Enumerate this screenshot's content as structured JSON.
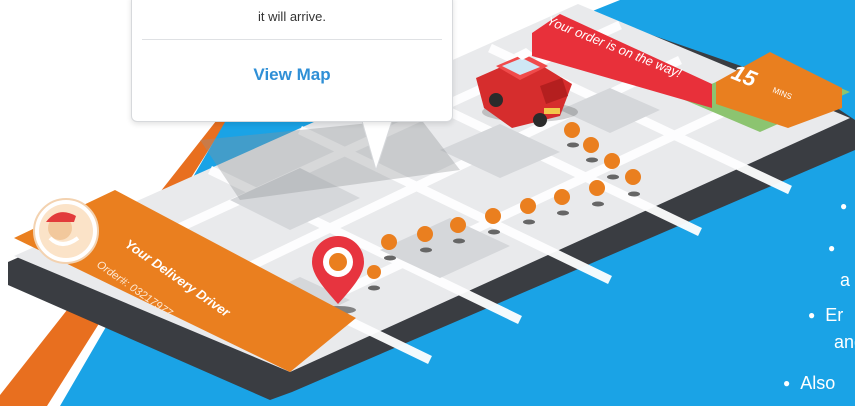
{
  "popover": {
    "message_tail": "it will arrive.",
    "link_label": "View Map"
  },
  "banner": {
    "status_text": "Your order is on the way!",
    "eta_value": "15",
    "eta_unit": "MINS"
  },
  "driver_card": {
    "title": "Your Delivery Driver",
    "order_label": "Order#: 03217977"
  },
  "bullets": [
    {
      "text": ""
    },
    {
      "text": ""
    },
    {
      "text": "a"
    },
    {
      "text": "Er"
    },
    {
      "text": "and"
    },
    {
      "text": "Also"
    }
  ],
  "colors": {
    "sky_blue": "#1aa3e6",
    "brand_orange": "#e97f1f",
    "banner_red": "#e8303a",
    "link_blue": "#2f8fd6",
    "pin_red": "#e7343f"
  },
  "icons": {
    "map_pin": "map-pin-icon",
    "car": "delivery-car-icon",
    "driver_avatar": "driver-avatar-icon"
  }
}
